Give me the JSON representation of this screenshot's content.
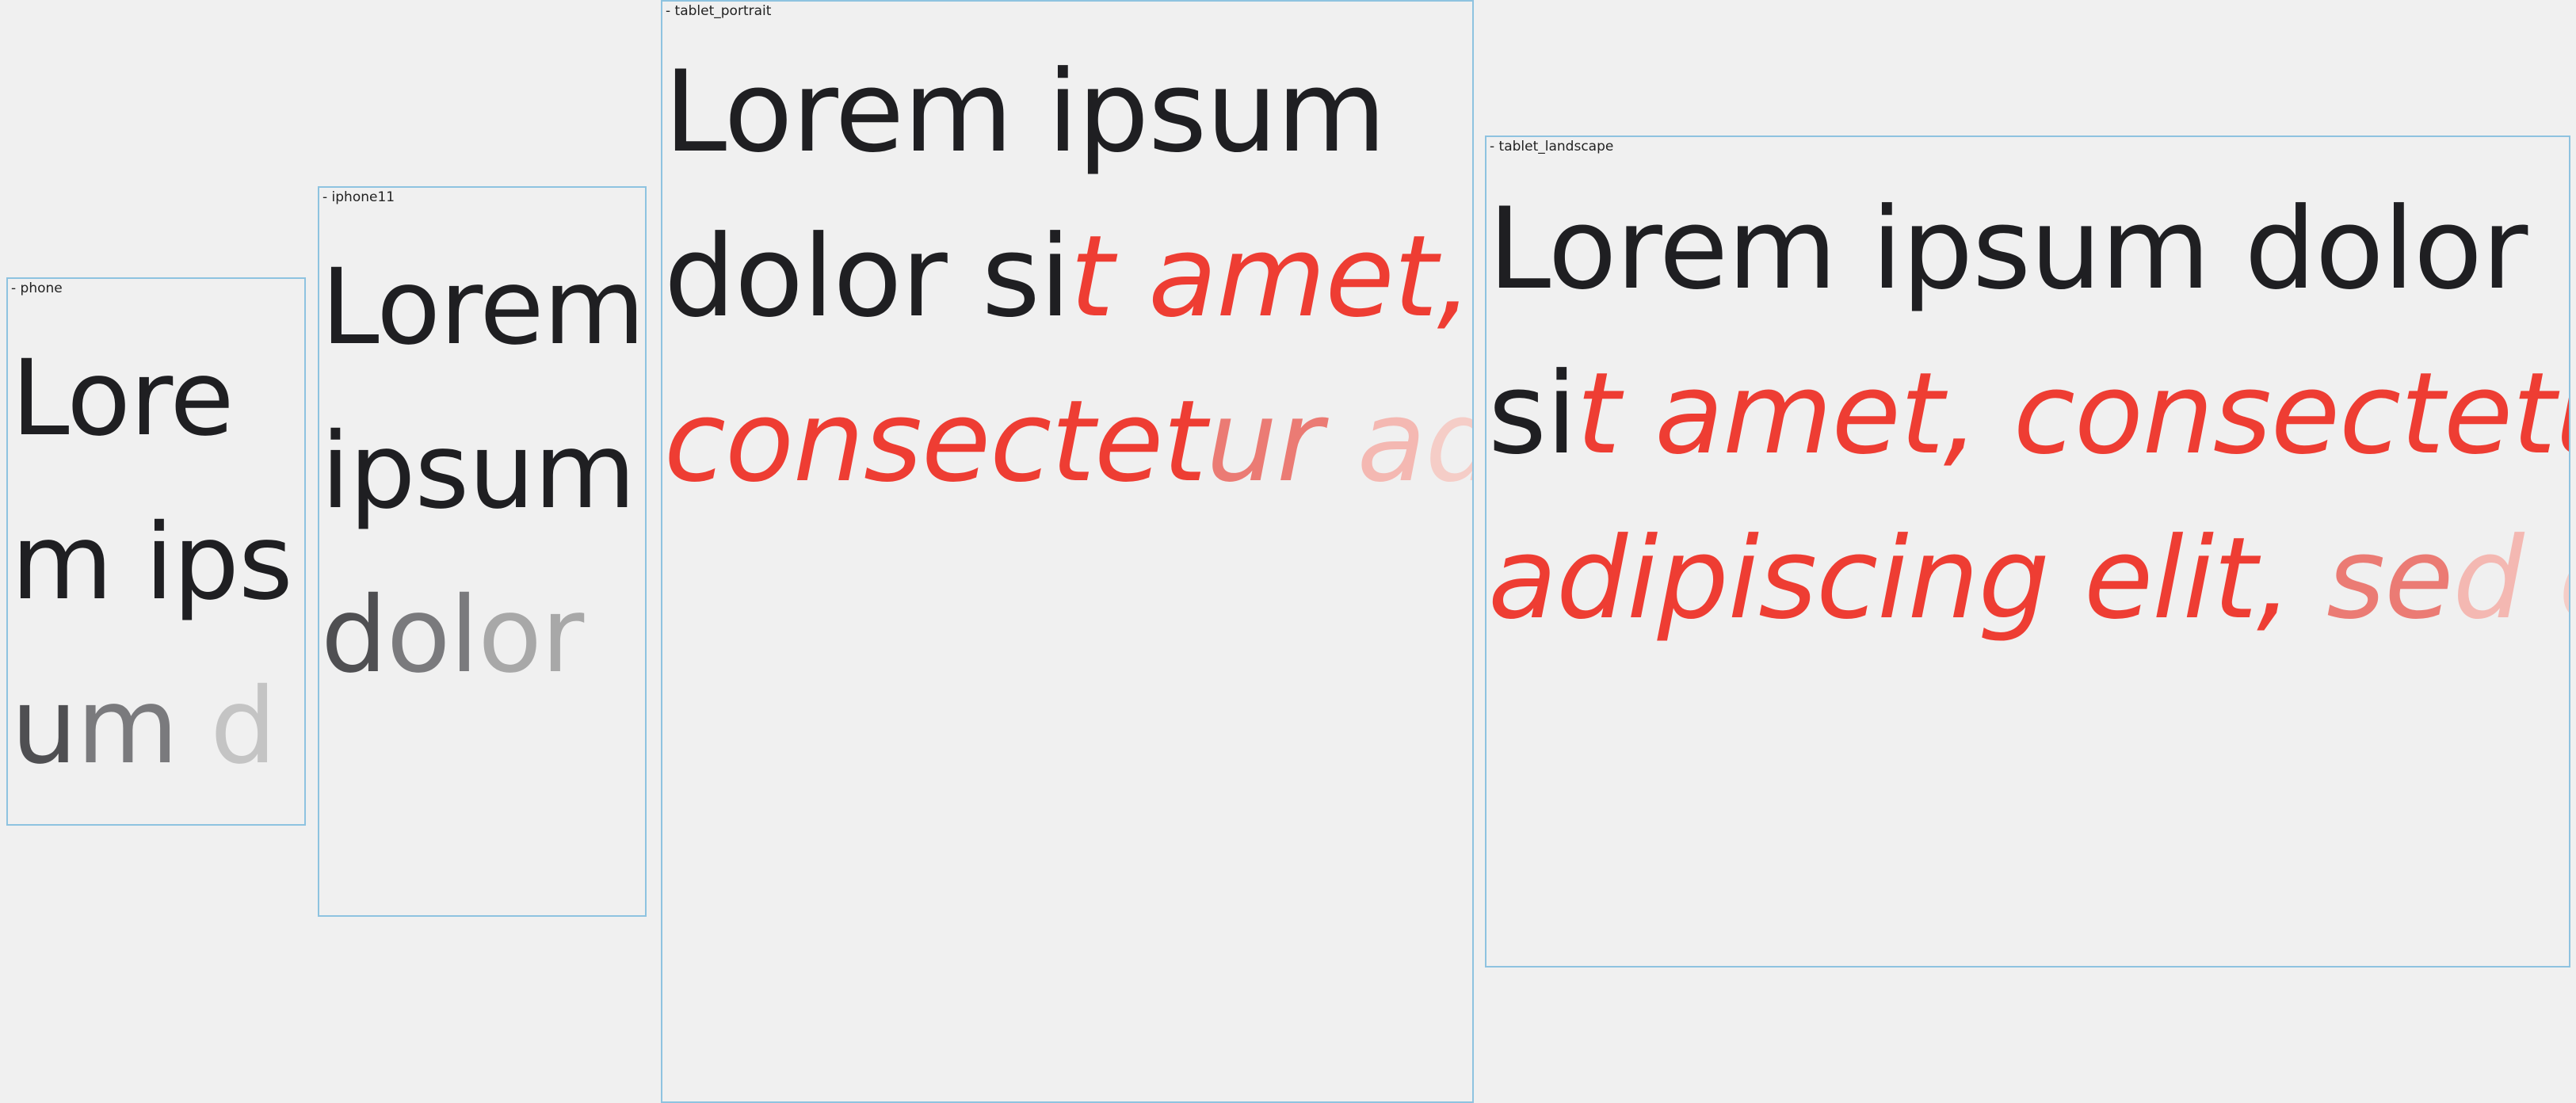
{
  "frames": {
    "phone": {
      "label": "- phone",
      "lines": [
        {
          "a": "Lore"
        },
        {
          "a": "m ips"
        },
        {
          "a": "u",
          "b": "m ",
          "c": "d"
        }
      ]
    },
    "iphone11": {
      "label": "- iphone11",
      "lines": [
        {
          "a": "Lorem"
        },
        {
          "a": "ipsum"
        },
        {
          "a": "d",
          "b": "ol",
          "c": "or"
        }
      ]
    },
    "tablet_portrait": {
      "label": "- tablet_portrait",
      "lines": [
        {
          "a": "Lorem ipsum"
        },
        {
          "a": "dolor si",
          "b": "t amet,"
        },
        {
          "a": "consectet",
          "b": "ur ",
          "c": "a",
          "d": "d"
        }
      ]
    },
    "tablet_landscape": {
      "label": "- tablet_landscape",
      "lines": [
        {
          "a": "Lorem ipsum dolor"
        },
        {
          "a": "si",
          "b": "t amet, consectetur"
        },
        {
          "a": "adipiscing elit,",
          "b": " se",
          "c": "d ",
          "d": "d"
        }
      ]
    }
  },
  "colors": {
    "frame_border": "#8ec3e0",
    "text_dark": "#1f1f22",
    "accent_red": "#ee3d33",
    "background": "#f0f0f0"
  }
}
